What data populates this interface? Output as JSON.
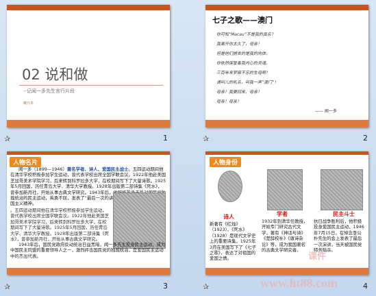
{
  "slides": [
    {
      "number": "1",
      "title": "02 说和做",
      "subtitle": "--记闻一多先生言行片段",
      "author": "曦元本"
    },
    {
      "number": "2",
      "title": "七子之歌——澳门",
      "lines": [
        "你可知“Macau”不是我的真名？",
        "我离开你太久了，母亲！",
        "但是他们掳去的是我的肉体，",
        "你依然保管着我内心的灵魂。",
        "三百年来梦寐不忘的生母啊！",
        "请叫儿的乳名，叫我一声“澳门”！",
        "母亲！我要回来，母亲！",
        "母亲！母亲！"
      ],
      "sign": "—— 闻一多"
    },
    {
      "number": "3",
      "tag": "人物名片",
      "intro_a": "闻一多（1899—1946）",
      "intro_b": "著名学者、诗人、爱国民主战士",
      "body": "。五四运动期间他在清华学校积极参加学生运动，曾代表学校出席全国学联会议。1922年他赴美国芝加哥美术学院学习，后来转到科罗拉多大学，在校期间写下了大量诗歌。1925年5月回国，历任青岛大学、清华大学教授。1928年出版第二部诗集《死水》，曾参加新月社，开始从事古典文学研究。1943年后，他积极投身于反对国民党独裁统治的民主运动，英勇不屈，发表了“最后一次的讲演”，表现了无所畏惧的爱国主义精神。",
      "para2": "1943年后，国民党政府反动统治日益黑暗，闻一多先生投身民主运动，成为中国民主同盟的重要领导人之一，激烈抨击国民党的独裁统治，是爱国民主运动中的杰出代表。"
    },
    {
      "number": "4",
      "tag": "人物身份",
      "roles": [
        "诗人",
        "学者",
        "民主斗士"
      ],
      "col1": "新著有《红烛》（1923）、《死水》（1928）是现代文学史上的重要诗集，1925年3月在美国写下了《七子之歌》，表达了对祖国的爱国之情。",
      "col2": "1932年到清华任教授，开始专门研究古代文学，著有《神话与诗》《楚辞校补》《唐诗杂论》等，成为我国著名的古典文学研究者。",
      "col3": "抗日战争胜利后，他积极投身爱国民主运动，1946年7月15日，在悼念李公朴先生的会上发表了最后一次演讲，当天被国民党特务暗杀。"
    }
  ],
  "watermark": {
    "url": "www.ht88.com",
    "brand": "课件"
  }
}
